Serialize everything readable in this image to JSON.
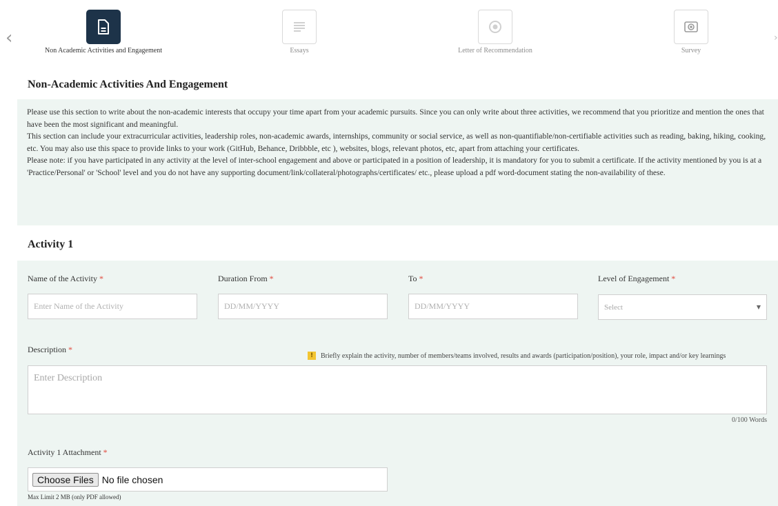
{
  "stepper": {
    "prev_arrow": "‹",
    "next_arrow": "›",
    "steps": [
      {
        "label": "Non Academic Activities and Engagement",
        "icon": "document-icon",
        "active": true
      },
      {
        "label": "Essays",
        "icon": "essay-lines-icon",
        "active": false
      },
      {
        "label": "Letter of Recommendation",
        "icon": "recommendation-seal-icon",
        "active": false
      },
      {
        "label": "Survey",
        "icon": "survey-camera-icon",
        "active": false
      }
    ]
  },
  "section": {
    "title": "Non-Academic Activities And Engagement",
    "instructions": [
      "Please use this section to write about the non-academic interests that occupy your time apart from your academic pursuits. Since you can only write about three activities, we recommend that you prioritize and mention the ones that have been the most significant and meaningful.",
      "This section can include your extracurricular activities, leadership roles, non-academic awards, internships, community or social service, as well as non-quantifiable/non-certifiable activities such as reading, baking, hiking, cooking, etc. You may also use this space to provide links to your work (GitHub, Behance, Dribbble, etc ), websites, blogs, relevant photos, etc, apart from attaching your certificates.",
      "Please note: if you have participated in any activity at the level of inter-school engagement and above or participated in a position of leadership, it is mandatory for you to submit a certificate. If the activity mentioned by you is at a 'Practice/Personal' or 'School' level and you do not have any supporting document/link/collateral/photographs/certificates/ etc., please upload a pdf word-document stating the non-availability of these."
    ]
  },
  "activity": {
    "title": "Activity 1",
    "required_marker": "*",
    "name": {
      "label": "Name of the Activity",
      "placeholder": "Enter Name of the Activity",
      "value": ""
    },
    "duration_from": {
      "label": "Duration From",
      "placeholder": "DD/MM/YYYY",
      "value": ""
    },
    "duration_to": {
      "label": "To",
      "placeholder": "DD/MM/YYYY",
      "value": ""
    },
    "level": {
      "label": "Level of Engagement",
      "selected": "Select",
      "caret": "▼"
    },
    "description": {
      "label": "Description",
      "hint_icon": "!",
      "hint": "Briefly explain the activity, number of members/teams involved, results and awards (participation/position), your role, impact and/or key learnings",
      "placeholder": "Enter Description",
      "value": "",
      "word_count": "0/100 Words"
    },
    "attachment": {
      "label": "Activity 1 Attachment",
      "button": "Choose Files",
      "status": "No file chosen",
      "note": "Max Limit 2 MB (only PDF allowed)"
    }
  },
  "colors": {
    "active_step": "#1d3349",
    "panel_background": "#eef5f2",
    "required": "#e0463a",
    "warning": "#f3c532"
  }
}
